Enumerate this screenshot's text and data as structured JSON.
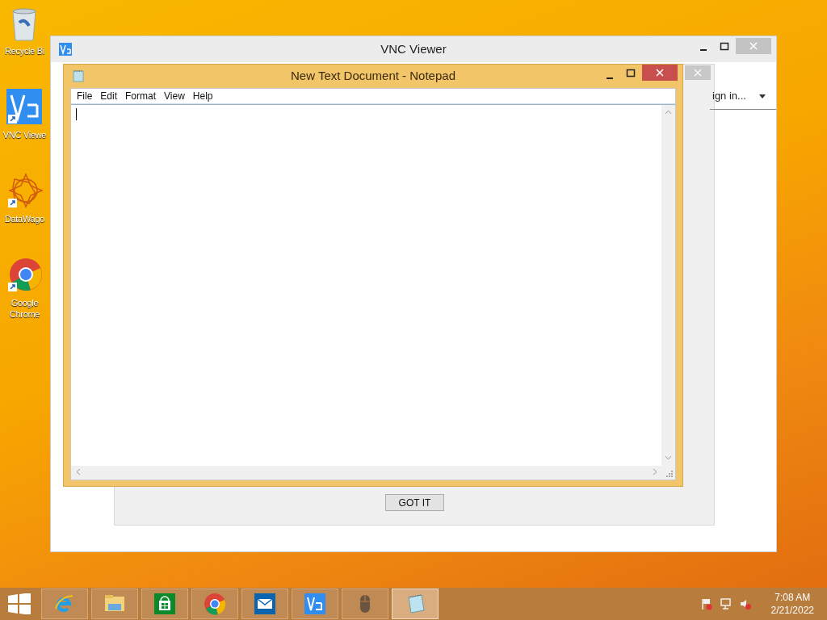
{
  "desktop_icons": [
    {
      "kind": "recycle",
      "label": "Recycle Bi"
    },
    {
      "kind": "vnc",
      "label": "VNC Viewe"
    },
    {
      "kind": "datawagon",
      "label": "DataWago"
    },
    {
      "kind": "chrome",
      "label": "Google Chrome"
    }
  ],
  "vnc_window": {
    "title": "VNC Viewer",
    "account_menu": "ign in...",
    "button": "GOT IT"
  },
  "notepad": {
    "title": "New Text Document - Notepad",
    "menu": [
      "File",
      "Edit",
      "Format",
      "View",
      "Help"
    ]
  },
  "taskbar": {
    "items": [
      {
        "kind": "ie",
        "selected": false
      },
      {
        "kind": "explorer",
        "selected": false
      },
      {
        "kind": "store",
        "selected": false
      },
      {
        "kind": "chrome",
        "selected": false
      },
      {
        "kind": "mail",
        "selected": false
      },
      {
        "kind": "vnc",
        "selected": false
      },
      {
        "kind": "mouse",
        "selected": false
      },
      {
        "kind": "notepad",
        "selected": true
      }
    ],
    "time": "7:08 AM",
    "date": "2/21/2022"
  }
}
